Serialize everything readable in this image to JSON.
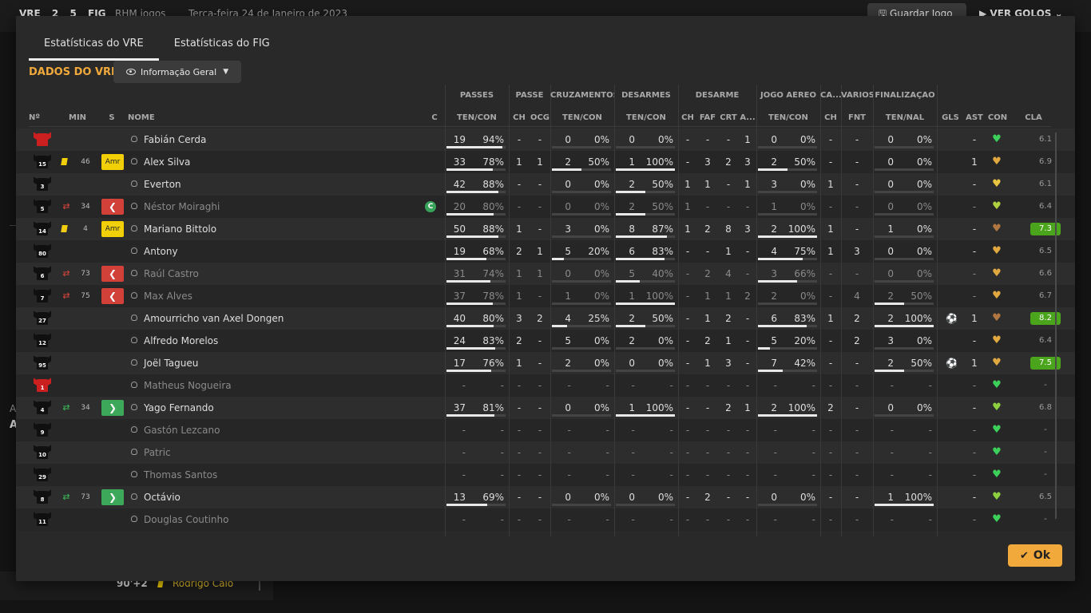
{
  "background": {
    "home": "VRE",
    "home_score": "2",
    "away_score": "5",
    "away": "FIG",
    "highlights": "RHM jogos",
    "date": "Terça-feira 24 de Janeiro de 2023",
    "save_label": "Guardar Jogo",
    "goals_label": "VER GOLOS",
    "event_time": "90'+2",
    "event_player": "Rodrigo Caio",
    "side_a1": "A",
    "side_a2": "A"
  },
  "tabs": [
    "Estatísticas do VRE",
    "Estatísticas do FIG"
  ],
  "section_title": "DADOS DO VRE",
  "dropdown_label": "Informação Geral",
  "group_headers": [
    "PASSES",
    "PASSE",
    "CRUZAMENTOS",
    "DESARMES",
    "DESARME",
    "JOGO AÉREO",
    "CA...",
    "VÁRIOS",
    "FINALIZAÇÃO"
  ],
  "col_headers": {
    "num": "Nº",
    "min": "MIN",
    "s": "S",
    "nome": "NOME",
    "c": "C",
    "passes_tc": "TEN/CON",
    "passe_ch": "CH",
    "passe_ocg": "OCG",
    "cruz_tc": "TEN/CON",
    "des_tc": "TEN/CON",
    "dsm_ch": "CH",
    "dsm_faf": "FAF",
    "dsm_crt": "CRT",
    "dsm_a": "A...",
    "aer_tc": "TEN/CON",
    "ca_ch": "CH",
    "var_fnt": "FNT",
    "fin_tn": "TEN/NAL",
    "gls": "GLS",
    "ast": "AST",
    "con": "CON",
    "cla": "CLA"
  },
  "players": [
    {
      "num": "",
      "red": true,
      "name": "Fabián Cerda",
      "dim": false,
      "card": false,
      "sub": "",
      "min": "",
      "badge": "",
      "cap": false,
      "p_a": "19",
      "p_b": "94%",
      "p_f": 0.94,
      "ps_ch": "-",
      "ps_ocg": "-",
      "cr_a": "0",
      "cr_b": "0%",
      "cr_f": 0,
      "de_a": "0",
      "de_b": "0%",
      "de_f": 0,
      "d_ch": "-",
      "d_faf": "-",
      "d_crt": "-",
      "d_a": "1",
      "ae_a": "0",
      "ae_b": "0%",
      "ae_f": 0,
      "ca_ch": "-",
      "fnt": "-",
      "fi_a": "0",
      "fi_b": "0%",
      "fi_f": 0,
      "gls": "",
      "ast": "-",
      "con": "#3cd05a",
      "cla": "6.1",
      "cla_good": false
    },
    {
      "num": "15",
      "red": false,
      "name": "Alex Silva",
      "dim": false,
      "card": true,
      "sub": "",
      "min": "46",
      "badge": "Amr",
      "cap": false,
      "p_a": "33",
      "p_b": "78%",
      "p_f": 0.78,
      "ps_ch": "1",
      "ps_ocg": "1",
      "cr_a": "2",
      "cr_b": "50%",
      "cr_f": 0.5,
      "de_a": "1",
      "de_b": "100%",
      "de_f": 1,
      "d_ch": "-",
      "d_faf": "3",
      "d_crt": "2",
      "d_a": "3",
      "ae_a": "2",
      "ae_b": "50%",
      "ae_f": 0.5,
      "ca_ch": "-",
      "fnt": "-",
      "fi_a": "0",
      "fi_b": "0%",
      "fi_f": 0,
      "gls": "",
      "ast": "1",
      "con": "#e0a840",
      "cla": "6.9",
      "cla_good": false
    },
    {
      "num": "3",
      "red": false,
      "name": "Everton",
      "dim": false,
      "card": false,
      "sub": "",
      "min": "",
      "badge": "",
      "cap": false,
      "p_a": "42",
      "p_b": "88%",
      "p_f": 0.88,
      "ps_ch": "-",
      "ps_ocg": "-",
      "cr_a": "0",
      "cr_b": "0%",
      "cr_f": 0,
      "de_a": "2",
      "de_b": "50%",
      "de_f": 0.5,
      "d_ch": "1",
      "d_faf": "1",
      "d_crt": "-",
      "d_a": "1",
      "ae_a": "3",
      "ae_b": "0%",
      "ae_f": 0,
      "ca_ch": "1",
      "fnt": "-",
      "fi_a": "0",
      "fi_b": "0%",
      "fi_f": 0,
      "gls": "",
      "ast": "-",
      "con": "#e8c440",
      "cla": "6.1",
      "cla_good": false
    },
    {
      "num": "5",
      "red": false,
      "name": "Néstor Moiraghi",
      "dim": true,
      "card": false,
      "sub": "out",
      "min": "34",
      "badge": "out",
      "cap": true,
      "p_a": "20",
      "p_b": "80%",
      "p_f": 0.8,
      "ps_ch": "-",
      "ps_ocg": "-",
      "cr_a": "0",
      "cr_b": "0%",
      "cr_f": 0,
      "de_a": "2",
      "de_b": "50%",
      "de_f": 0.5,
      "d_ch": "1",
      "d_faf": "-",
      "d_crt": "-",
      "d_a": "-",
      "ae_a": "1",
      "ae_b": "0%",
      "ae_f": 0,
      "ca_ch": "-",
      "fnt": "-",
      "fi_a": "0",
      "fi_b": "0%",
      "fi_f": 0,
      "gls": "",
      "ast": "-",
      "con": "#b0d040",
      "cla": "6.4",
      "cla_good": false
    },
    {
      "num": "14",
      "red": false,
      "name": "Mariano Bittolo",
      "dim": false,
      "card": true,
      "sub": "",
      "min": "4",
      "badge": "Amr",
      "cap": false,
      "p_a": "50",
      "p_b": "88%",
      "p_f": 0.88,
      "ps_ch": "1",
      "ps_ocg": "-",
      "cr_a": "3",
      "cr_b": "0%",
      "cr_f": 0,
      "de_a": "8",
      "de_b": "87%",
      "de_f": 0.87,
      "d_ch": "1",
      "d_faf": "2",
      "d_crt": "8",
      "d_a": "3",
      "ae_a": "2",
      "ae_b": "100%",
      "ae_f": 1,
      "ca_ch": "1",
      "fnt": "-",
      "fi_a": "1",
      "fi_b": "0%",
      "fi_f": 0,
      "gls": "",
      "ast": "-",
      "con": "#b07840",
      "cla": "7.3",
      "cla_good": true
    },
    {
      "num": "80",
      "red": false,
      "name": "Antony",
      "dim": false,
      "card": false,
      "sub": "",
      "min": "",
      "badge": "",
      "cap": false,
      "p_a": "19",
      "p_b": "68%",
      "p_f": 0.68,
      "ps_ch": "2",
      "ps_ocg": "1",
      "cr_a": "5",
      "cr_b": "20%",
      "cr_f": 0.2,
      "de_a": "6",
      "de_b": "83%",
      "de_f": 0.83,
      "d_ch": "-",
      "d_faf": "-",
      "d_crt": "1",
      "d_a": "-",
      "ae_a": "4",
      "ae_b": "75%",
      "ae_f": 0.75,
      "ca_ch": "1",
      "fnt": "3",
      "fi_a": "0",
      "fi_b": "0%",
      "fi_f": 0,
      "gls": "",
      "ast": "-",
      "con": "#e0a840",
      "cla": "6.5",
      "cla_good": false
    },
    {
      "num": "6",
      "red": false,
      "name": "Raúl Castro",
      "dim": true,
      "card": false,
      "sub": "out",
      "min": "73",
      "badge": "out",
      "cap": false,
      "p_a": "31",
      "p_b": "74%",
      "p_f": 0.74,
      "ps_ch": "1",
      "ps_ocg": "1",
      "cr_a": "0",
      "cr_b": "0%",
      "cr_f": 0,
      "de_a": "5",
      "de_b": "40%",
      "de_f": 0.4,
      "d_ch": "-",
      "d_faf": "2",
      "d_crt": "4",
      "d_a": "-",
      "ae_a": "3",
      "ae_b": "66%",
      "ae_f": 0.66,
      "ca_ch": "-",
      "fnt": "-",
      "fi_a": "0",
      "fi_b": "0%",
      "fi_f": 0,
      "gls": "",
      "ast": "-",
      "con": "#e0a840",
      "cla": "6.6",
      "cla_good": false
    },
    {
      "num": "7",
      "red": false,
      "name": "Max Alves",
      "dim": true,
      "card": false,
      "sub": "out",
      "min": "75",
      "badge": "out",
      "cap": false,
      "p_a": "37",
      "p_b": "78%",
      "p_f": 0.78,
      "ps_ch": "1",
      "ps_ocg": "-",
      "cr_a": "1",
      "cr_b": "0%",
      "cr_f": 0,
      "de_a": "1",
      "de_b": "100%",
      "de_f": 1,
      "d_ch": "-",
      "d_faf": "1",
      "d_crt": "1",
      "d_a": "2",
      "ae_a": "2",
      "ae_b": "0%",
      "ae_f": 0,
      "ca_ch": "-",
      "fnt": "4",
      "fi_a": "2",
      "fi_b": "50%",
      "fi_f": 0.5,
      "gls": "",
      "ast": "-",
      "con": "#e0a840",
      "cla": "6.7",
      "cla_good": false
    },
    {
      "num": "27",
      "red": false,
      "name": "Amourricho van Axel Dongen",
      "dim": false,
      "card": false,
      "sub": "",
      "min": "",
      "badge": "",
      "cap": false,
      "p_a": "40",
      "p_b": "80%",
      "p_f": 0.8,
      "ps_ch": "3",
      "ps_ocg": "2",
      "cr_a": "4",
      "cr_b": "25%",
      "cr_f": 0.25,
      "de_a": "2",
      "de_b": "50%",
      "de_f": 0.5,
      "d_ch": "-",
      "d_faf": "1",
      "d_crt": "2",
      "d_a": "-",
      "ae_a": "6",
      "ae_b": "83%",
      "ae_f": 0.83,
      "ca_ch": "1",
      "fnt": "2",
      "fi_a": "2",
      "fi_b": "100%",
      "fi_f": 1,
      "gls": "goal",
      "ast": "1",
      "con": "#b07840",
      "cla": "8.2",
      "cla_good": true
    },
    {
      "num": "12",
      "red": false,
      "name": "Alfredo Morelos",
      "dim": false,
      "card": false,
      "sub": "",
      "min": "",
      "badge": "",
      "cap": false,
      "p_a": "24",
      "p_b": "83%",
      "p_f": 0.83,
      "ps_ch": "2",
      "ps_ocg": "-",
      "cr_a": "5",
      "cr_b": "0%",
      "cr_f": 0,
      "de_a": "2",
      "de_b": "0%",
      "de_f": 0,
      "d_ch": "-",
      "d_faf": "2",
      "d_crt": "1",
      "d_a": "-",
      "ae_a": "5",
      "ae_b": "20%",
      "ae_f": 0.2,
      "ca_ch": "-",
      "fnt": "2",
      "fi_a": "3",
      "fi_b": "0%",
      "fi_f": 0,
      "gls": "",
      "ast": "-",
      "con": "#e0a840",
      "cla": "6.4",
      "cla_good": false
    },
    {
      "num": "95",
      "red": false,
      "name": "Joël Tagueu",
      "dim": false,
      "card": false,
      "sub": "",
      "min": "",
      "badge": "",
      "cap": false,
      "p_a": "17",
      "p_b": "76%",
      "p_f": 0.76,
      "ps_ch": "1",
      "ps_ocg": "-",
      "cr_a": "2",
      "cr_b": "0%",
      "cr_f": 0,
      "de_a": "0",
      "de_b": "0%",
      "de_f": 0,
      "d_ch": "-",
      "d_faf": "1",
      "d_crt": "3",
      "d_a": "-",
      "ae_a": "7",
      "ae_b": "42%",
      "ae_f": 0.42,
      "ca_ch": "-",
      "fnt": "-",
      "fi_a": "2",
      "fi_b": "50%",
      "fi_f": 0.5,
      "gls": "goal",
      "ast": "1",
      "con": "#e0a840",
      "cla": "7.5",
      "cla_good": true
    },
    {
      "num": "1",
      "red": true,
      "name": "Matheus Nogueira",
      "dim": true,
      "card": false,
      "sub": "",
      "min": "",
      "badge": "",
      "cap": false,
      "p_a": "-",
      "p_b": "-",
      "p_f": null,
      "ps_ch": "-",
      "ps_ocg": "-",
      "cr_a": "-",
      "cr_b": "-",
      "cr_f": null,
      "de_a": "-",
      "de_b": "-",
      "de_f": null,
      "d_ch": "-",
      "d_faf": "-",
      "d_crt": "-",
      "d_a": "-",
      "ae_a": "-",
      "ae_b": "-",
      "ae_f": null,
      "ca_ch": "-",
      "fnt": "-",
      "fi_a": "-",
      "fi_b": "-",
      "fi_f": null,
      "gls": "",
      "ast": "-",
      "con": "#3cd05a",
      "cla": "-",
      "cla_good": false
    },
    {
      "num": "4",
      "red": false,
      "name": "Yago Fernando",
      "dim": false,
      "card": false,
      "sub": "in",
      "min": "34",
      "badge": "in",
      "cap": false,
      "p_a": "37",
      "p_b": "81%",
      "p_f": 0.81,
      "ps_ch": "-",
      "ps_ocg": "-",
      "cr_a": "0",
      "cr_b": "0%",
      "cr_f": 0,
      "de_a": "1",
      "de_b": "100%",
      "de_f": 1,
      "d_ch": "-",
      "d_faf": "-",
      "d_crt": "2",
      "d_a": "1",
      "ae_a": "2",
      "ae_b": "100%",
      "ae_f": 1,
      "ca_ch": "2",
      "fnt": "-",
      "fi_a": "0",
      "fi_b": "0%",
      "fi_f": 0,
      "gls": "",
      "ast": "-",
      "con": "#8cd040",
      "cla": "6.8",
      "cla_good": false
    },
    {
      "num": "9",
      "red": false,
      "name": "Gastón Lezcano",
      "dim": true,
      "card": false,
      "sub": "",
      "min": "",
      "badge": "",
      "cap": false,
      "p_a": "-",
      "p_b": "-",
      "p_f": null,
      "ps_ch": "-",
      "ps_ocg": "-",
      "cr_a": "-",
      "cr_b": "-",
      "cr_f": null,
      "de_a": "-",
      "de_b": "-",
      "de_f": null,
      "d_ch": "-",
      "d_faf": "-",
      "d_crt": "-",
      "d_a": "-",
      "ae_a": "-",
      "ae_b": "-",
      "ae_f": null,
      "ca_ch": "-",
      "fnt": "-",
      "fi_a": "-",
      "fi_b": "-",
      "fi_f": null,
      "gls": "",
      "ast": "-",
      "con": "#3cd05a",
      "cla": "-",
      "cla_good": false
    },
    {
      "num": "10",
      "red": false,
      "name": "Patric",
      "dim": true,
      "card": false,
      "sub": "",
      "min": "",
      "badge": "",
      "cap": false,
      "p_a": "-",
      "p_b": "-",
      "p_f": null,
      "ps_ch": "-",
      "ps_ocg": "-",
      "cr_a": "-",
      "cr_b": "-",
      "cr_f": null,
      "de_a": "-",
      "de_b": "-",
      "de_f": null,
      "d_ch": "-",
      "d_faf": "-",
      "d_crt": "-",
      "d_a": "-",
      "ae_a": "-",
      "ae_b": "-",
      "ae_f": null,
      "ca_ch": "-",
      "fnt": "-",
      "fi_a": "-",
      "fi_b": "-",
      "fi_f": null,
      "gls": "",
      "ast": "-",
      "con": "#3cd05a",
      "cla": "-",
      "cla_good": false
    },
    {
      "num": "29",
      "red": false,
      "name": "Thomas Santos",
      "dim": true,
      "card": false,
      "sub": "",
      "min": "",
      "badge": "",
      "cap": false,
      "p_a": "-",
      "p_b": "-",
      "p_f": null,
      "ps_ch": "-",
      "ps_ocg": "-",
      "cr_a": "-",
      "cr_b": "-",
      "cr_f": null,
      "de_a": "-",
      "de_b": "-",
      "de_f": null,
      "d_ch": "-",
      "d_faf": "-",
      "d_crt": "-",
      "d_a": "-",
      "ae_a": "-",
      "ae_b": "-",
      "ae_f": null,
      "ca_ch": "-",
      "fnt": "-",
      "fi_a": "-",
      "fi_b": "-",
      "fi_f": null,
      "gls": "",
      "ast": "-",
      "con": "#3cd05a",
      "cla": "-",
      "cla_good": false
    },
    {
      "num": "8",
      "red": false,
      "name": "Octávio",
      "dim": false,
      "card": false,
      "sub": "in",
      "min": "73",
      "badge": "in",
      "cap": false,
      "p_a": "13",
      "p_b": "69%",
      "p_f": 0.69,
      "ps_ch": "-",
      "ps_ocg": "-",
      "cr_a": "0",
      "cr_b": "0%",
      "cr_f": 0,
      "de_a": "0",
      "de_b": "0%",
      "de_f": 0,
      "d_ch": "-",
      "d_faf": "2",
      "d_crt": "-",
      "d_a": "-",
      "ae_a": "0",
      "ae_b": "0%",
      "ae_f": 0,
      "ca_ch": "-",
      "fnt": "-",
      "fi_a": "1",
      "fi_b": "100%",
      "fi_f": 1,
      "gls": "",
      "ast": "-",
      "con": "#8cd040",
      "cla": "6.5",
      "cla_good": false
    },
    {
      "num": "11",
      "red": false,
      "name": "Douglas Coutinho",
      "dim": true,
      "card": false,
      "sub": "",
      "min": "",
      "badge": "",
      "cap": false,
      "p_a": "-",
      "p_b": "-",
      "p_f": null,
      "ps_ch": "-",
      "ps_ocg": "-",
      "cr_a": "-",
      "cr_b": "-",
      "cr_f": null,
      "de_a": "-",
      "de_b": "-",
      "de_f": null,
      "d_ch": "-",
      "d_faf": "-",
      "d_crt": "-",
      "d_a": "-",
      "ae_a": "-",
      "ae_b": "-",
      "ae_f": null,
      "ca_ch": "-",
      "fnt": "-",
      "fi_a": "-",
      "fi_b": "-",
      "fi_f": null,
      "gls": "",
      "ast": "-",
      "con": "#3cd05a",
      "cla": "-",
      "cla_good": false
    }
  ],
  "ok_label": "Ok"
}
